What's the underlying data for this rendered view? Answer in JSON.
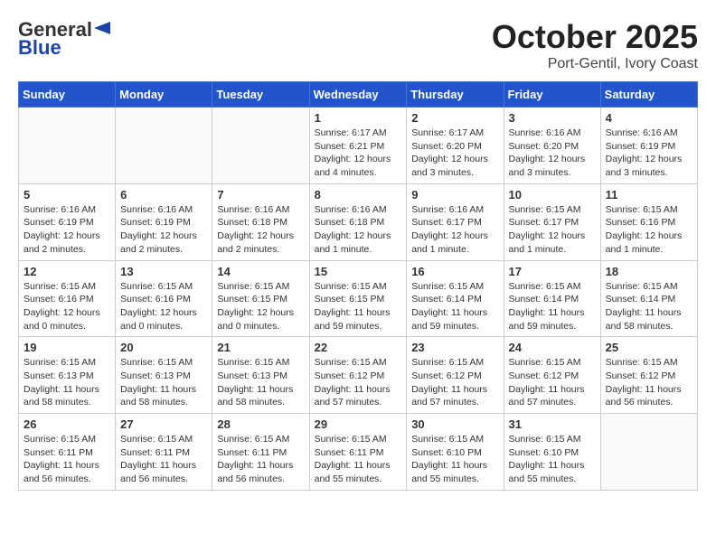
{
  "header": {
    "logo_general": "General",
    "logo_blue": "Blue",
    "month": "October 2025",
    "location": "Port-Gentil, Ivory Coast"
  },
  "weekdays": [
    "Sunday",
    "Monday",
    "Tuesday",
    "Wednesday",
    "Thursday",
    "Friday",
    "Saturday"
  ],
  "weeks": [
    [
      {
        "day": "",
        "info": ""
      },
      {
        "day": "",
        "info": ""
      },
      {
        "day": "",
        "info": ""
      },
      {
        "day": "1",
        "info": "Sunrise: 6:17 AM\nSunset: 6:21 PM\nDaylight: 12 hours\nand 4 minutes."
      },
      {
        "day": "2",
        "info": "Sunrise: 6:17 AM\nSunset: 6:20 PM\nDaylight: 12 hours\nand 3 minutes."
      },
      {
        "day": "3",
        "info": "Sunrise: 6:16 AM\nSunset: 6:20 PM\nDaylight: 12 hours\nand 3 minutes."
      },
      {
        "day": "4",
        "info": "Sunrise: 6:16 AM\nSunset: 6:19 PM\nDaylight: 12 hours\nand 3 minutes."
      }
    ],
    [
      {
        "day": "5",
        "info": "Sunrise: 6:16 AM\nSunset: 6:19 PM\nDaylight: 12 hours\nand 2 minutes."
      },
      {
        "day": "6",
        "info": "Sunrise: 6:16 AM\nSunset: 6:19 PM\nDaylight: 12 hours\nand 2 minutes."
      },
      {
        "day": "7",
        "info": "Sunrise: 6:16 AM\nSunset: 6:18 PM\nDaylight: 12 hours\nand 2 minutes."
      },
      {
        "day": "8",
        "info": "Sunrise: 6:16 AM\nSunset: 6:18 PM\nDaylight: 12 hours\nand 1 minute."
      },
      {
        "day": "9",
        "info": "Sunrise: 6:16 AM\nSunset: 6:17 PM\nDaylight: 12 hours\nand 1 minute."
      },
      {
        "day": "10",
        "info": "Sunrise: 6:15 AM\nSunset: 6:17 PM\nDaylight: 12 hours\nand 1 minute."
      },
      {
        "day": "11",
        "info": "Sunrise: 6:15 AM\nSunset: 6:16 PM\nDaylight: 12 hours\nand 1 minute."
      }
    ],
    [
      {
        "day": "12",
        "info": "Sunrise: 6:15 AM\nSunset: 6:16 PM\nDaylight: 12 hours\nand 0 minutes."
      },
      {
        "day": "13",
        "info": "Sunrise: 6:15 AM\nSunset: 6:16 PM\nDaylight: 12 hours\nand 0 minutes."
      },
      {
        "day": "14",
        "info": "Sunrise: 6:15 AM\nSunset: 6:15 PM\nDaylight: 12 hours\nand 0 minutes."
      },
      {
        "day": "15",
        "info": "Sunrise: 6:15 AM\nSunset: 6:15 PM\nDaylight: 11 hours\nand 59 minutes."
      },
      {
        "day": "16",
        "info": "Sunrise: 6:15 AM\nSunset: 6:14 PM\nDaylight: 11 hours\nand 59 minutes."
      },
      {
        "day": "17",
        "info": "Sunrise: 6:15 AM\nSunset: 6:14 PM\nDaylight: 11 hours\nand 59 minutes."
      },
      {
        "day": "18",
        "info": "Sunrise: 6:15 AM\nSunset: 6:14 PM\nDaylight: 11 hours\nand 58 minutes."
      }
    ],
    [
      {
        "day": "19",
        "info": "Sunrise: 6:15 AM\nSunset: 6:13 PM\nDaylight: 11 hours\nand 58 minutes."
      },
      {
        "day": "20",
        "info": "Sunrise: 6:15 AM\nSunset: 6:13 PM\nDaylight: 11 hours\nand 58 minutes."
      },
      {
        "day": "21",
        "info": "Sunrise: 6:15 AM\nSunset: 6:13 PM\nDaylight: 11 hours\nand 58 minutes."
      },
      {
        "day": "22",
        "info": "Sunrise: 6:15 AM\nSunset: 6:12 PM\nDaylight: 11 hours\nand 57 minutes."
      },
      {
        "day": "23",
        "info": "Sunrise: 6:15 AM\nSunset: 6:12 PM\nDaylight: 11 hours\nand 57 minutes."
      },
      {
        "day": "24",
        "info": "Sunrise: 6:15 AM\nSunset: 6:12 PM\nDaylight: 11 hours\nand 57 minutes."
      },
      {
        "day": "25",
        "info": "Sunrise: 6:15 AM\nSunset: 6:12 PM\nDaylight: 11 hours\nand 56 minutes."
      }
    ],
    [
      {
        "day": "26",
        "info": "Sunrise: 6:15 AM\nSunset: 6:11 PM\nDaylight: 11 hours\nand 56 minutes."
      },
      {
        "day": "27",
        "info": "Sunrise: 6:15 AM\nSunset: 6:11 PM\nDaylight: 11 hours\nand 56 minutes."
      },
      {
        "day": "28",
        "info": "Sunrise: 6:15 AM\nSunset: 6:11 PM\nDaylight: 11 hours\nand 56 minutes."
      },
      {
        "day": "29",
        "info": "Sunrise: 6:15 AM\nSunset: 6:11 PM\nDaylight: 11 hours\nand 55 minutes."
      },
      {
        "day": "30",
        "info": "Sunrise: 6:15 AM\nSunset: 6:10 PM\nDaylight: 11 hours\nand 55 minutes."
      },
      {
        "day": "31",
        "info": "Sunrise: 6:15 AM\nSunset: 6:10 PM\nDaylight: 11 hours\nand 55 minutes."
      },
      {
        "day": "",
        "info": ""
      }
    ]
  ]
}
